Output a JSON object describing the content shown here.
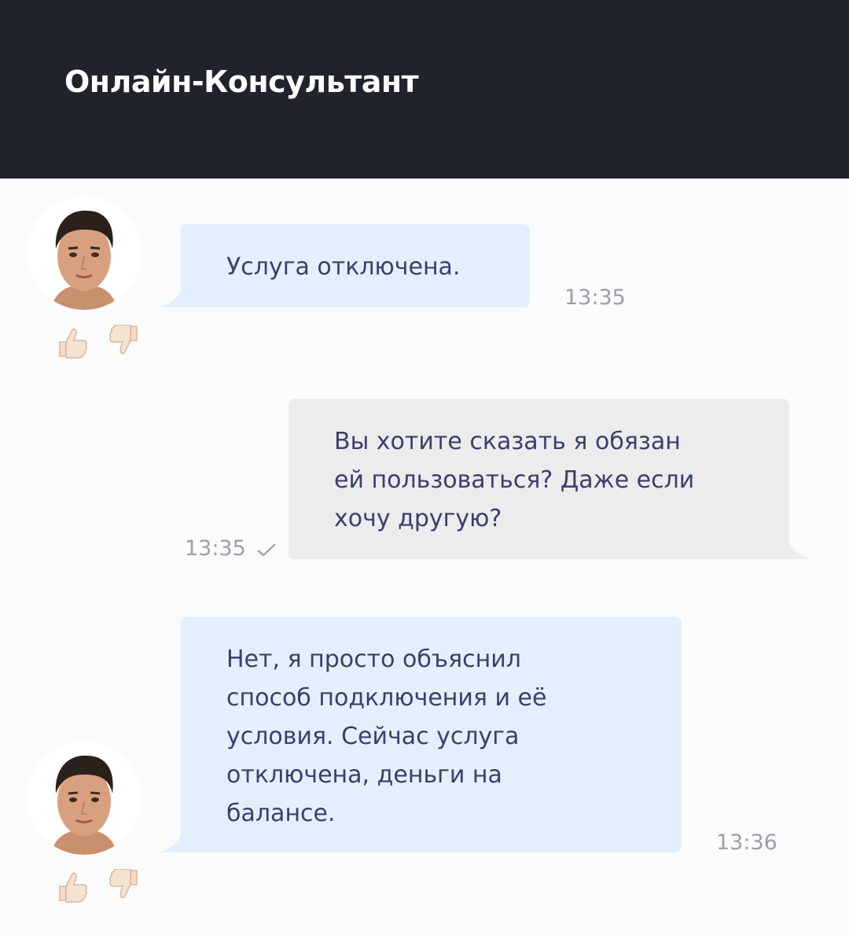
{
  "header": {
    "title": "Онлайн-Консультант"
  },
  "colors": {
    "header_bg": "#20232c",
    "operator_bubble": "#e2f0fd",
    "user_bubble": "#ececed",
    "message_text": "#3a3f6b",
    "timestamp": "#9aa0a8"
  },
  "messages": [
    {
      "sender": "operator",
      "text": "Услуга отключена.",
      "time": "13:35",
      "icons": [
        "operator-avatar",
        "thumbs-up-icon",
        "thumbs-down-icon"
      ]
    },
    {
      "sender": "user",
      "text": "Вы хотите сказать я обязан\nей пользоваться? Даже если\nхочу другую?",
      "time": "13:35",
      "icons": [
        "sent-check-icon"
      ]
    },
    {
      "sender": "operator",
      "text": "Нет, я просто объяснил\nспособ подключения и её\nусловия. Сейчас услуга\nотключена, деньги на\nбалансе.",
      "time": "13:36",
      "icons": [
        "operator-avatar",
        "thumbs-up-icon",
        "thumbs-down-icon"
      ]
    }
  ]
}
